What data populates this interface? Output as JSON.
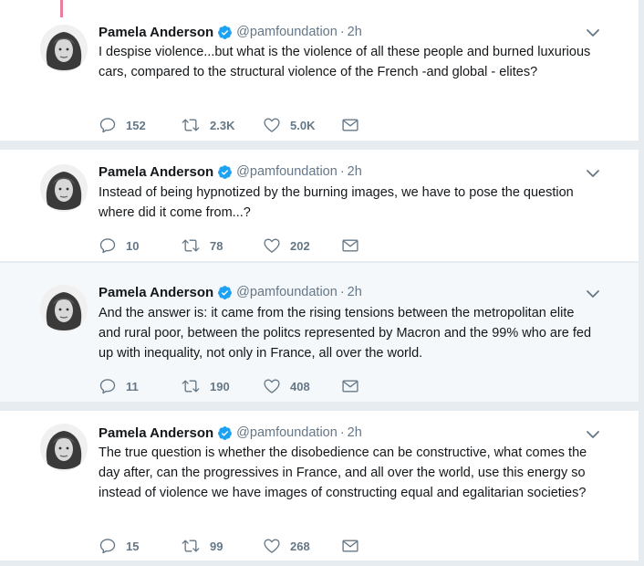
{
  "tweets": [
    {
      "name": "Pamela Anderson",
      "handle": "@pamfoundation",
      "separator": "·",
      "time": "2h",
      "text": "I despise violence...but what is the violence of all these people and burned luxurious cars, compared to the structural violence of the French -and global - elites?",
      "replies": "152",
      "retweets": "2.3K",
      "likes": "5.0K"
    },
    {
      "name": "Pamela Anderson",
      "handle": "@pamfoundation",
      "separator": "·",
      "time": "2h",
      "text": "Instead of being hypnotized by the burning images, we have to pose the question where did it come from...?",
      "replies": "10",
      "retweets": "78",
      "likes": "202"
    },
    {
      "name": "Pamela Anderson",
      "handle": "@pamfoundation",
      "separator": "·",
      "time": "2h",
      "text": "And the answer is: it came from the rising tensions between the metropolitan elite and rural poor, between the politcs represented by Macron and the 99% who are fed up with inequality, not only in France, all over the world.",
      "replies": "11",
      "retweets": "190",
      "likes": "408"
    },
    {
      "name": "Pamela Anderson",
      "handle": "@pamfoundation",
      "separator": "·",
      "time": "2h",
      "text": "The true question is whether the disobedience can be constructive, what comes the day after, can the progressives in France, and all over the world, use this energy so instead of violence we have images of constructing equal and egalitarian societies?",
      "replies": "15",
      "retweets": "99",
      "likes": "268"
    }
  ],
  "icons": {
    "reply": "reply-icon",
    "retweet": "retweet-icon",
    "like": "heart-icon",
    "message": "envelope-icon",
    "verified": "verified-badge-icon",
    "more": "chevron-down-icon"
  },
  "colors": {
    "background": "#e6ecf0",
    "card": "#ffffff",
    "card_highlight": "#f5f8fa",
    "text": "#14171a",
    "secondary": "#657786",
    "verified": "#1da1f2",
    "thread_line": "#e0245e"
  }
}
